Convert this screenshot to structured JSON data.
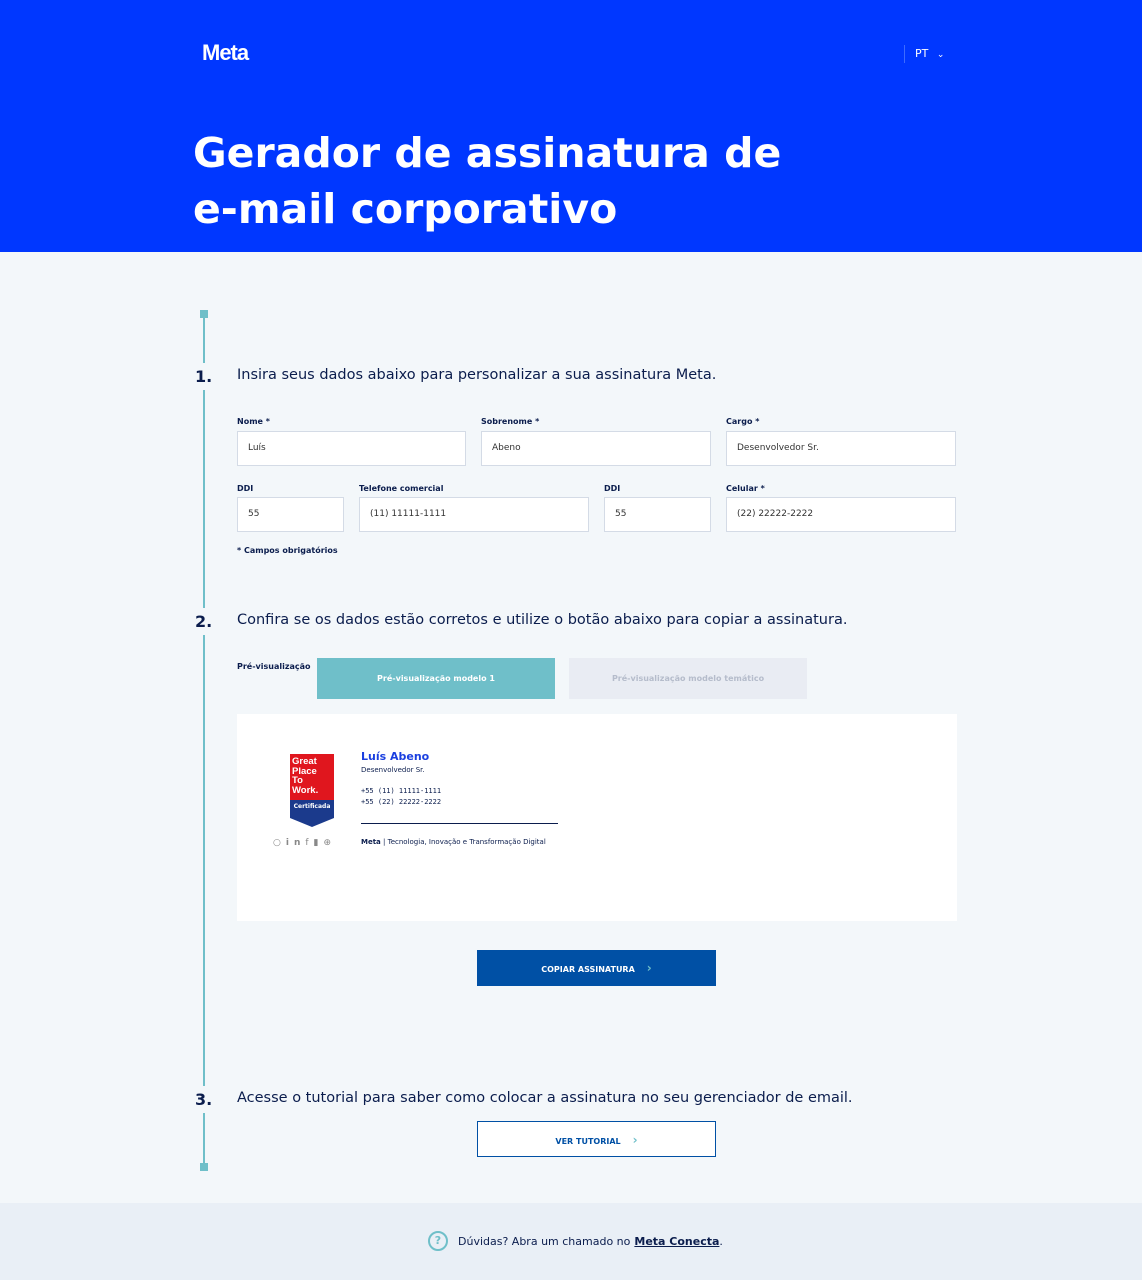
{
  "header": {
    "logo": "Meta",
    "language": "PT",
    "title_line1": "Gerador de assinatura de",
    "title_line2": "e-mail corporativo"
  },
  "steps": [
    {
      "number": "1.",
      "text": "Insira seus dados abaixo para personalizar a sua assinatura Meta."
    },
    {
      "number": "2.",
      "text": "Confira se os dados estão corretos e utilize o botão abaixo para copiar a assinatura."
    },
    {
      "number": "3.",
      "text": "Acesse o tutorial para saber como colocar a assinatura no seu gerenciador de email."
    }
  ],
  "form": {
    "nome": {
      "label": "Nome *",
      "value": "Luís"
    },
    "sobrenome": {
      "label": "Sobrenome *",
      "value": "Abeno"
    },
    "cargo": {
      "label": "Cargo *",
      "value": "Desenvolvedor Sr."
    },
    "ddi1": {
      "label": "DDI",
      "value": "55"
    },
    "telefone": {
      "label": "Telefone comercial",
      "value": "(11) 11111-1111"
    },
    "ddi2": {
      "label": "DDI",
      "value": "55"
    },
    "celular": {
      "label": "Celular *",
      "value": "(22) 22222-2222"
    },
    "required_note": "* Campos obrigatórios"
  },
  "preview": {
    "label": "Pré-visualização",
    "tabs": [
      "Pré-visualização modelo 1",
      "Pré-visualização modelo temático"
    ],
    "signature": {
      "name": "Luís Abeno",
      "role": "Desenvolvedor Sr.",
      "phone1": "+55 (11) 11111-1111",
      "phone2": "+55 (22) 22222-2222",
      "brand": "Meta",
      "tagline": "| Tecnologia, Inovação e Transformação Digital",
      "badge": {
        "line1": "Great",
        "line2": "Place",
        "line3": "To",
        "line4": "Work.",
        "cert": "Certificada"
      }
    }
  },
  "buttons": {
    "copy": "COPIAR ASSINATURA",
    "tutorial": "VER TUTORIAL"
  },
  "footer": {
    "text": "Dúvidas? Abra um chamado no ",
    "link": "Meta Conecta",
    "end": "."
  },
  "colors": {
    "brand": "#0037ff",
    "teal": "#6fbfc9",
    "button": "#0050a5"
  }
}
